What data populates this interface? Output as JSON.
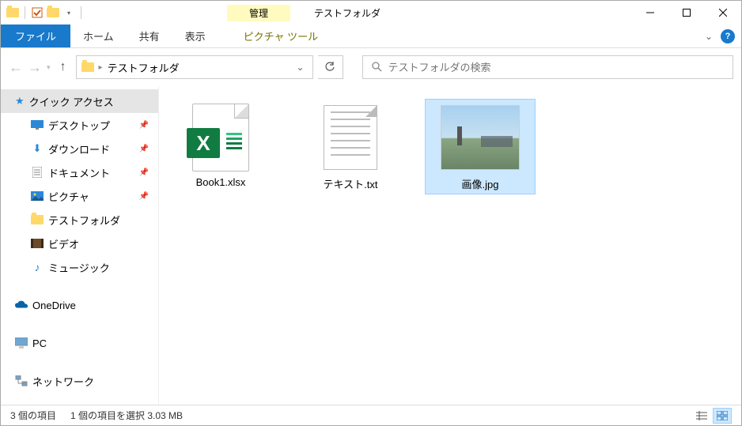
{
  "titlebar": {
    "contextual_label": "管理",
    "window_title": "テストフォルダ"
  },
  "ribbon": {
    "file": "ファイル",
    "tabs": [
      "ホーム",
      "共有",
      "表示"
    ],
    "contextual_tab": "ピクチャ ツール"
  },
  "address": {
    "crumb": "テストフォルダ"
  },
  "search": {
    "placeholder": "テストフォルダの検索"
  },
  "navpane": {
    "quick_access": "クイック アクセス",
    "items": [
      {
        "icon": "desktop",
        "label": "デスクトップ",
        "pinned": true
      },
      {
        "icon": "download",
        "label": "ダウンロード",
        "pinned": true
      },
      {
        "icon": "document",
        "label": "ドキュメント",
        "pinned": true
      },
      {
        "icon": "picture",
        "label": "ピクチャ",
        "pinned": true
      },
      {
        "icon": "folder",
        "label": "テストフォルダ",
        "pinned": false
      },
      {
        "icon": "video",
        "label": "ビデオ",
        "pinned": false
      },
      {
        "icon": "music",
        "label": "ミュージック",
        "pinned": false
      }
    ],
    "onedrive": "OneDrive",
    "pc": "PC",
    "network": "ネットワーク"
  },
  "files": [
    {
      "name": "Book1.xlsx",
      "type": "excel",
      "selected": false
    },
    {
      "name": "テキスト.txt",
      "type": "text",
      "selected": false
    },
    {
      "name": "画像.jpg",
      "type": "image",
      "selected": true
    }
  ],
  "status": {
    "count": "3 個の項目",
    "selection": "1 個の項目を選択 3.03 MB"
  }
}
